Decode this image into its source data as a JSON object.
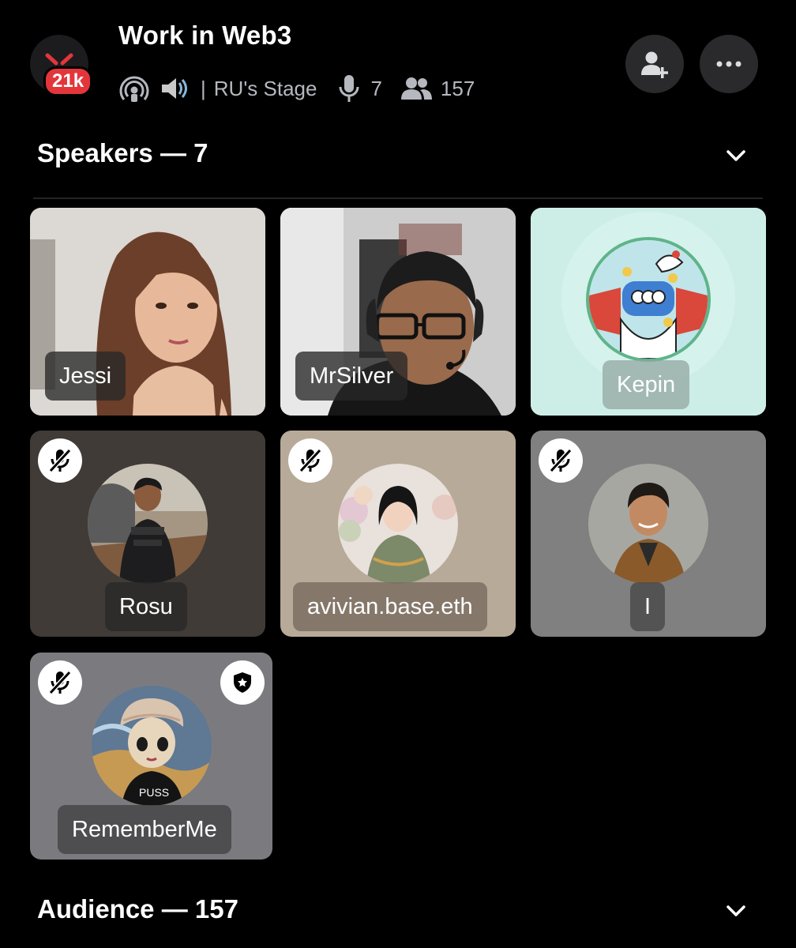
{
  "header": {
    "server_badge": "21k",
    "stage_title": "Work in Web3",
    "stage_name": "RU's Stage",
    "speaker_count": "7",
    "listener_count": "157",
    "icons": [
      "stage-icon",
      "speaker-volume-icon",
      "microphone-icon",
      "people-icon",
      "add-friend-icon",
      "more-icon"
    ]
  },
  "speakers_section": {
    "label": "Speakers — 7"
  },
  "audience_section": {
    "label": "Audience — 157"
  },
  "speakers": [
    {
      "name": "Jessi",
      "video": true,
      "muted": false
    },
    {
      "name": "MrSilver",
      "video": true,
      "muted": false
    },
    {
      "name": "Kepin",
      "video": false,
      "muted": false
    },
    {
      "name": "Rosu",
      "video": false,
      "muted": true
    },
    {
      "name": "avivian.base.eth",
      "video": false,
      "muted": true
    },
    {
      "name": "I",
      "video": false,
      "muted": true
    },
    {
      "name": "RememberMe",
      "video": false,
      "muted": true,
      "moderator": true
    }
  ],
  "colors": {
    "badge_red": "#e2363b",
    "kepin_tile": "#cdeee7",
    "rosu_tile": "#403b36",
    "avivian_tile": "#b7aa99",
    "i_tile": "#808080",
    "rememberme_tile": "#7b7b7f"
  }
}
